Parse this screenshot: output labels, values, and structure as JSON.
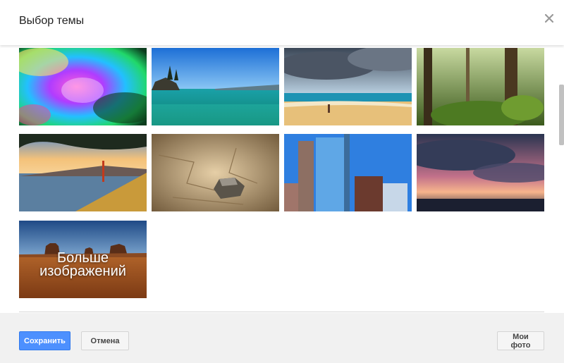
{
  "dialog": {
    "title": "Выбор темы"
  },
  "icons": {
    "close": "close-icon"
  },
  "themes": [
    {
      "name": "theme-bokeh"
    },
    {
      "name": "theme-lake"
    },
    {
      "name": "theme-beach"
    },
    {
      "name": "theme-forest"
    },
    {
      "name": "theme-golden-gate"
    },
    {
      "name": "theme-desert-rock"
    },
    {
      "name": "theme-city"
    },
    {
      "name": "theme-storm"
    }
  ],
  "more_images": {
    "label_line1": "Больше",
    "label_line2": "изображений"
  },
  "footer": {
    "save_label": "Сохранить",
    "cancel_label": "Отмена",
    "my_photos_label": "Мои фото"
  },
  "colors": {
    "primary": "#4d90fe",
    "primary_border": "#3079ed",
    "footer_bg": "#f1f1f1"
  }
}
